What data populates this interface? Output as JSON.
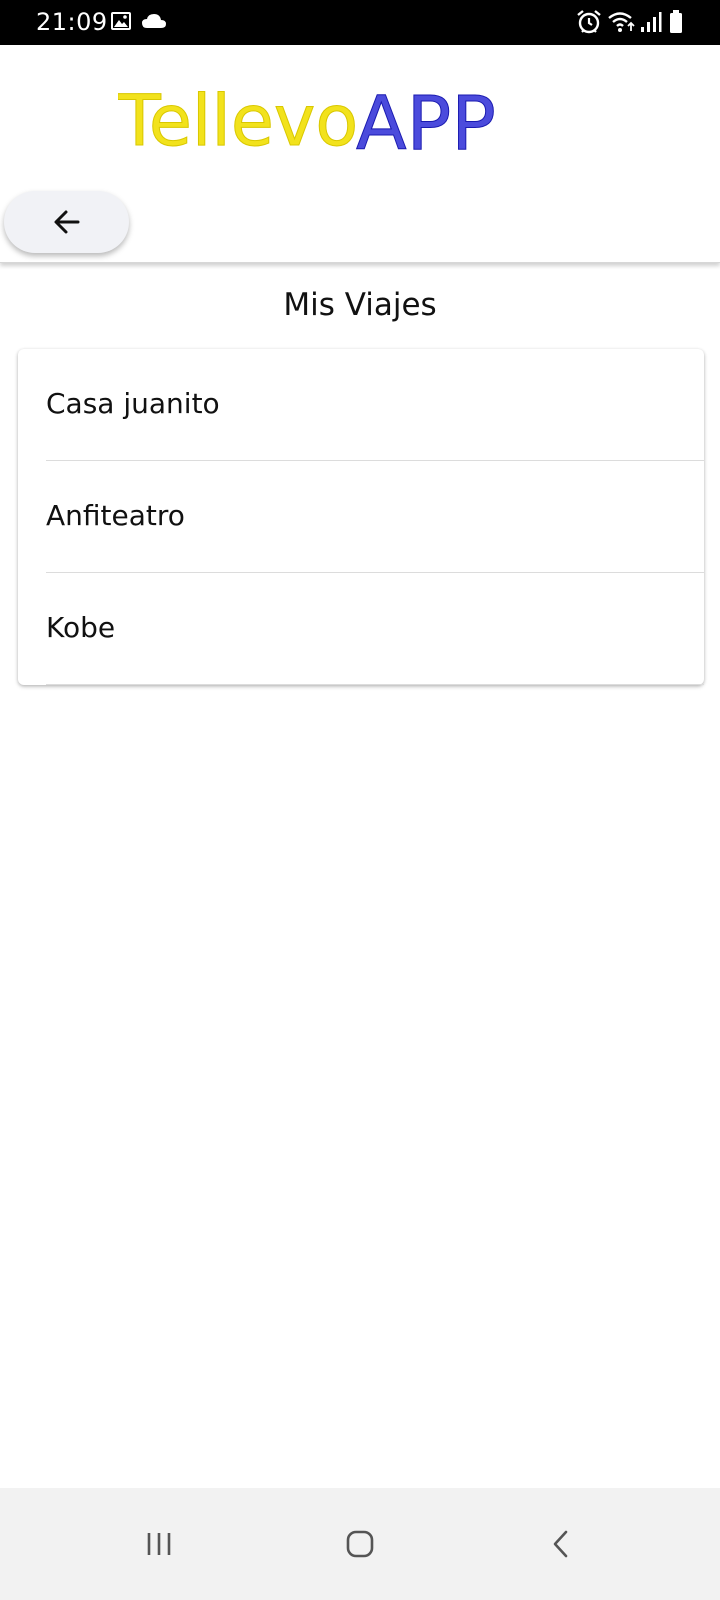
{
  "status_bar": {
    "time": "21:09",
    "icons": [
      "image-icon",
      "cloud-icon",
      "alarm-icon",
      "wifi-icon",
      "signal-icon",
      "battery-icon"
    ]
  },
  "header": {
    "logo_text_part1": "Tellevo",
    "logo_text_part2": "APP",
    "logo_colors": {
      "part1": "#f2e21c",
      "part2": "#2b2bd6"
    },
    "back_icon": "arrow-left-icon"
  },
  "main": {
    "title": "Mis Viajes",
    "trips": [
      {
        "label": "Casa juanito"
      },
      {
        "label": "Anfiteatro"
      },
      {
        "label": "Kobe"
      }
    ]
  },
  "nav_bar": {
    "icons": [
      "recent-apps-icon",
      "home-icon",
      "back-nav-icon"
    ]
  }
}
